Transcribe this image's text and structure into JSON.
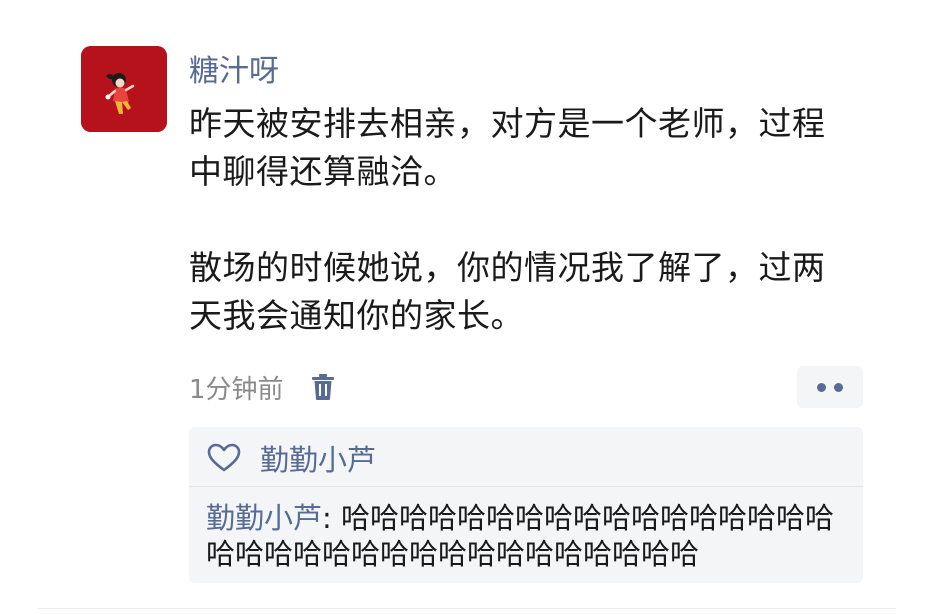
{
  "post": {
    "username": "糖汁呀",
    "body": [
      "昨天被安排去相亲，对方是一个老师，过程中聊得还算融洽。",
      "散场的时候她说，你的情况我了解了，过两天我会通知你的家长。"
    ],
    "timestamp": "1分钟前"
  },
  "likes": {
    "names": "勤勤小芦"
  },
  "comments": [
    {
      "author": "勤勤小芦",
      "separator": ": ",
      "text": "哈哈哈哈哈哈哈哈哈哈哈哈哈哈哈哈哈哈哈哈哈哈哈哈哈哈哈哈哈哈哈哈哈哈"
    }
  ],
  "icons": {
    "avatar": "avatar-illustration",
    "delete": "trash-icon",
    "more": "more-dots-icon",
    "like": "heart-icon"
  },
  "colors": {
    "link": "#576b95",
    "avatar_bg": "#b5121b",
    "panel_bg": "#f4f5f7",
    "muted": "#8a8a8a"
  }
}
